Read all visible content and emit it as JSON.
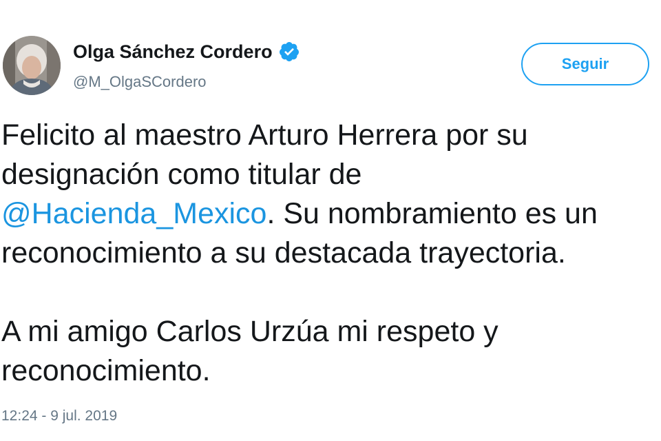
{
  "author": {
    "display_name": "Olga Sánchez Cordero",
    "handle": "@M_OlgaSCordero",
    "verified_icon": "verified-badge-icon",
    "avatar": "avatar-photo"
  },
  "follow_button": {
    "label": "Seguir"
  },
  "tweet": {
    "paragraph1": {
      "line1": "Felicito al maestro Arturo Herrera por su",
      "line2": "designación como titular de",
      "mention": "@Hacienda_Mexico",
      "line3_rest": ". Su nombramiento es un",
      "line4": "reconocimiento a su destacada trayectoria."
    },
    "paragraph2": {
      "line1": "A mi amigo Carlos Urzúa mi respeto y",
      "line2": "reconocimiento."
    },
    "timestamp": "12:24 - 9 jul. 2019"
  },
  "colors": {
    "accent": "#1da1f2",
    "mention": "#1b95e0",
    "muted": "#657786",
    "text": "#14171a"
  }
}
